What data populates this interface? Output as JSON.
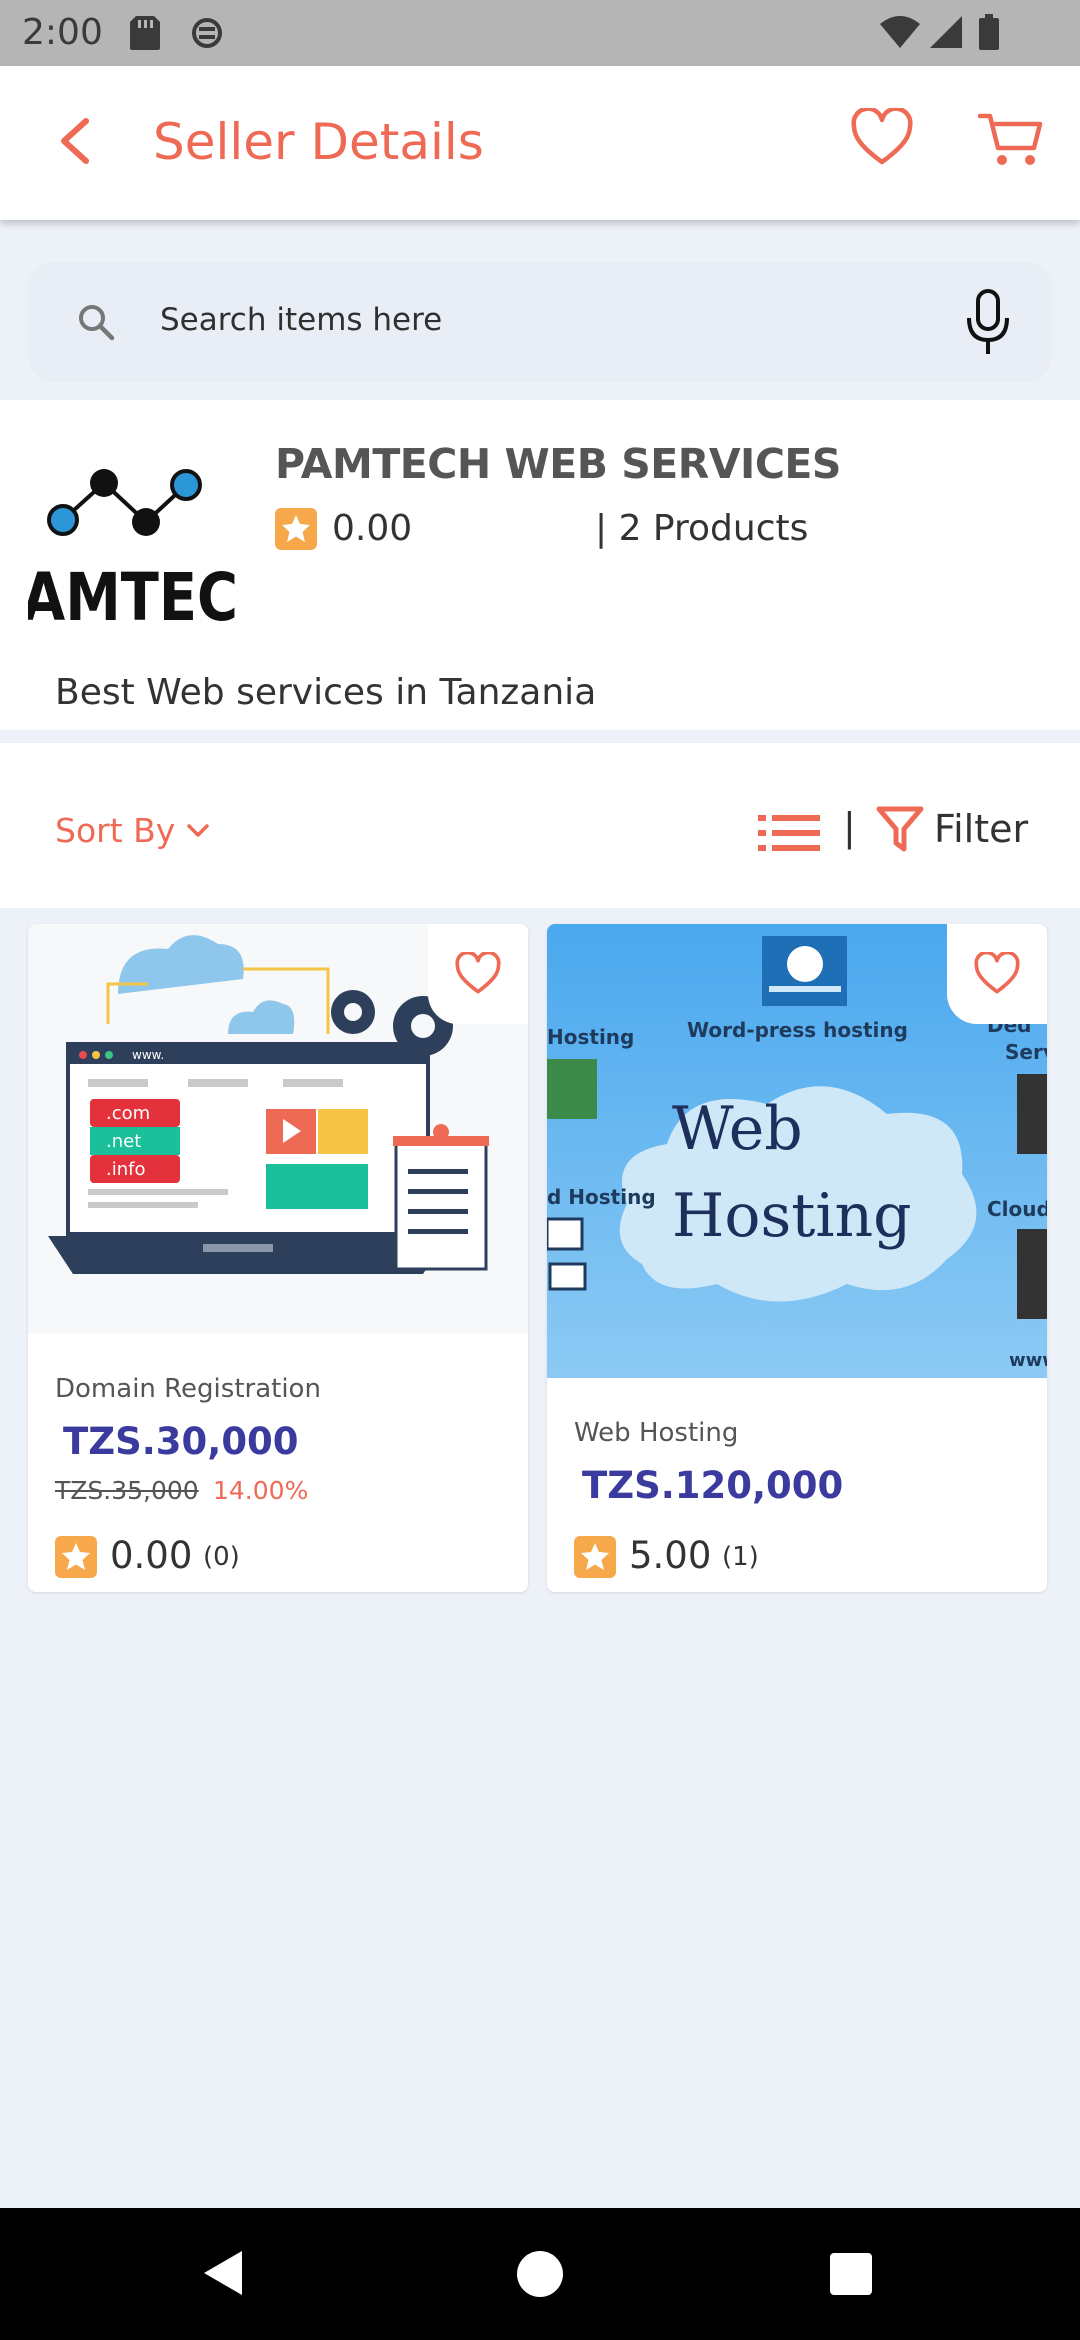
{
  "status_bar": {
    "time": "2:00"
  },
  "app_bar": {
    "title": "Seller Details"
  },
  "search": {
    "placeholder": "Search items here"
  },
  "seller": {
    "logo_text": "AMTEC",
    "name": "PAMTECH WEB SERVICES",
    "rating": "0.00",
    "products": "| 2 Products",
    "description": "Best Web services in Tanzania"
  },
  "toolbar": {
    "sort_label": "Sort By",
    "divider": "|",
    "filter_label": "Filter"
  },
  "products": [
    {
      "name": "Domain Registration",
      "price": "TZS.30,000",
      "old_price": "TZS.35,000",
      "discount": "14.00%",
      "rating": "0.00",
      "review_count": "(0)",
      "image_labels": [
        ".com",
        ".net",
        ".info",
        "www."
      ]
    },
    {
      "name": "Web Hosting",
      "price": "TZS.120,000",
      "rating": "5.00",
      "review_count": "(1)",
      "image_labels": [
        "Web",
        "Hosting",
        "Word-press hosting",
        "Hosting",
        "d Hosting",
        "Cloud",
        "Ded",
        "Serv",
        "www"
      ]
    }
  ],
  "colors": {
    "accent": "#ee6a55",
    "price": "#3b3a9e",
    "background": "#edf1f8",
    "star": "#f7a84a"
  }
}
